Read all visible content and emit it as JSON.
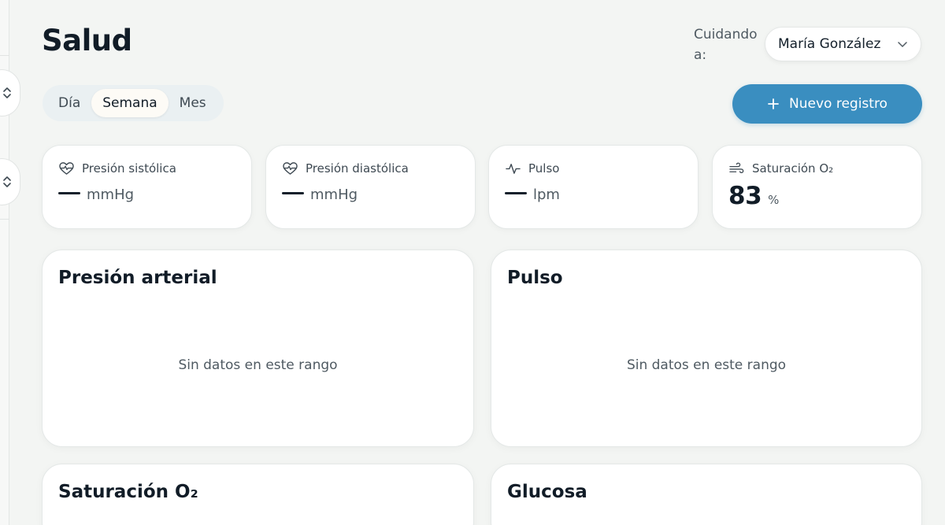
{
  "header": {
    "title": "Salud",
    "caring_label": "Cuidando a:",
    "selected_person": "María González"
  },
  "range_tabs": [
    {
      "label": "Día",
      "active": false
    },
    {
      "label": "Semana",
      "active": true
    },
    {
      "label": "Mes",
      "active": false
    }
  ],
  "new_record_label": "Nuevo registro",
  "stats": {
    "systolic": {
      "label": "Presión sistólica",
      "unit": "mmHg",
      "icon": "heart-pulse-icon"
    },
    "diastolic": {
      "label": "Presión diastólica",
      "unit": "mmHg",
      "icon": "heart-pulse-icon"
    },
    "pulse": {
      "label": "Pulso",
      "unit": "lpm",
      "icon": "activity-icon"
    },
    "saturation": {
      "label": "Saturación O₂",
      "value": "83",
      "unit": "%",
      "icon": "wind-icon"
    }
  },
  "cards": {
    "blood_pressure": {
      "title": "Presión arterial",
      "empty": "Sin datos en este rango"
    },
    "pulse": {
      "title": "Pulso",
      "empty": "Sin datos en este rango"
    },
    "saturation": {
      "title": "Saturación O₂"
    },
    "glucose": {
      "title": "Glucosa"
    }
  },
  "colors": {
    "accent": "#3a8ec0",
    "background": "#f3f5f3",
    "text": "#14202b"
  }
}
